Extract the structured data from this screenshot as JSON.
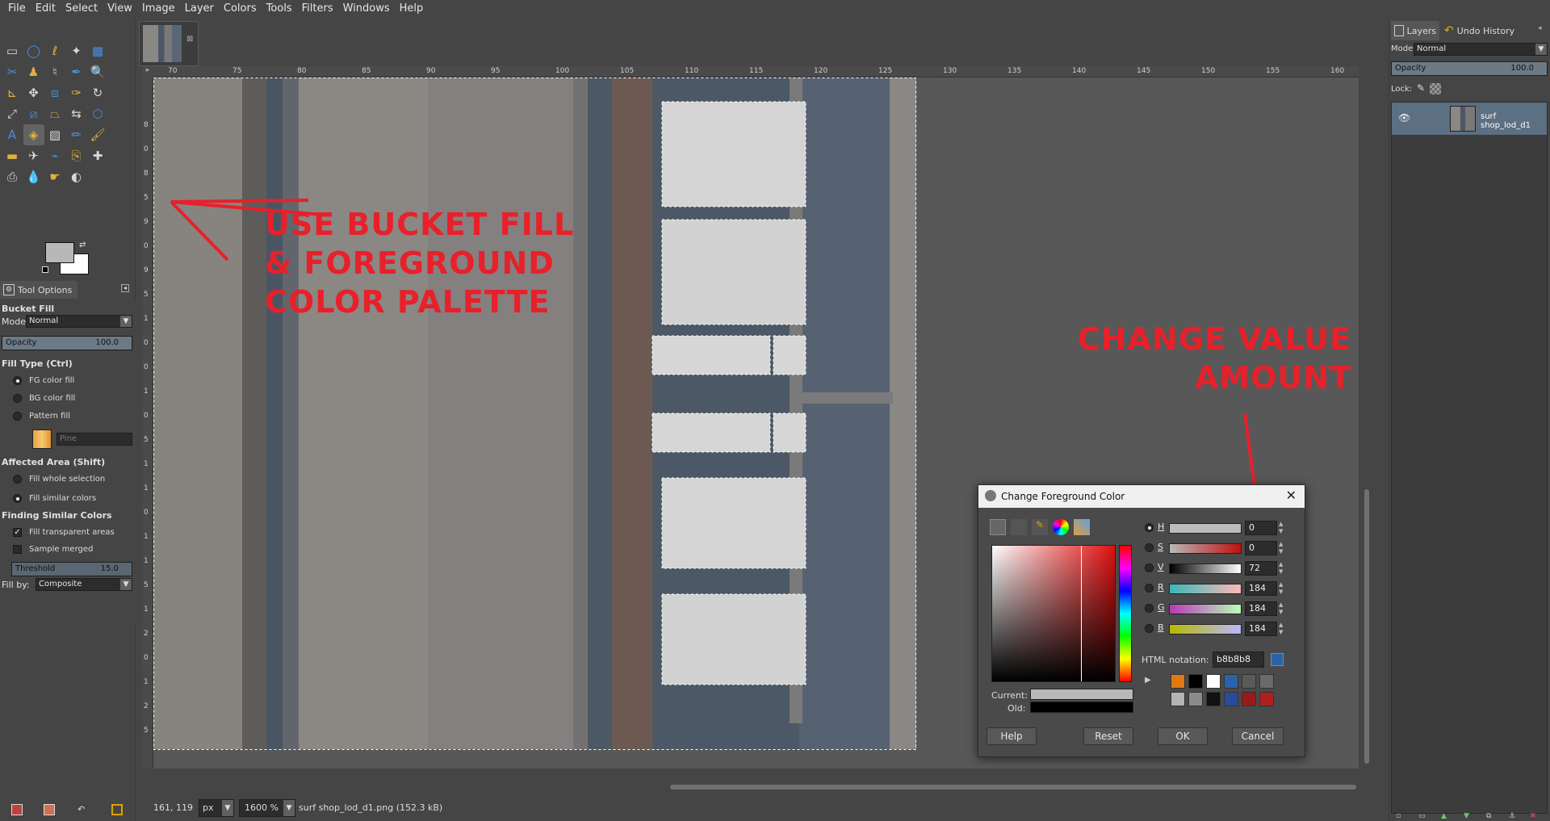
{
  "menu": [
    "File",
    "Edit",
    "Select",
    "View",
    "Image",
    "Layer",
    "Colors",
    "Tools",
    "Filters",
    "Windows",
    "Help"
  ],
  "tool_options": {
    "tab_label": "Tool Options",
    "tool_name": "Bucket Fill",
    "mode_label": "Mode:",
    "mode_value": "Normal",
    "opacity_label": "Opacity",
    "opacity_value": "100.0",
    "fill_type_label": "Fill Type  (Ctrl)",
    "fill_types": [
      "FG color fill",
      "BG color fill",
      "Pattern fill"
    ],
    "pattern_name": "Pine",
    "affected_area_label": "Affected Area  (Shift)",
    "affected_areas": [
      "Fill whole selection",
      "Fill similar colors"
    ],
    "finding_similar_label": "Finding Similar Colors",
    "fill_transparent": "Fill transparent areas",
    "sample_merged": "Sample merged",
    "threshold_label": "Threshold",
    "threshold_value": "15.0",
    "fill_by_label": "Fill by:",
    "fill_by_value": "Composite"
  },
  "ruler_top": [
    "70",
    "75",
    "80",
    "85",
    "90",
    "95",
    "100",
    "105",
    "110",
    "115",
    "120",
    "125",
    "130",
    "135",
    "140",
    "145",
    "150",
    "155",
    "160"
  ],
  "ruler_left": [
    "8",
    "0",
    "8",
    "5",
    "9",
    "0",
    "9",
    "5",
    "1",
    "0",
    "0",
    "1",
    "0",
    "5",
    "1",
    "1",
    "0",
    "1",
    "1",
    "5",
    "1",
    "2",
    "0",
    "1",
    "2",
    "5"
  ],
  "annotations": {
    "left_text": [
      "USE BUCKET FILL",
      "& FOREGROUND",
      "COLOR PALETTE"
    ],
    "right_text": [
      "CHANGE VALUE",
      "AMOUNT"
    ],
    "color": "#e8202a"
  },
  "status": {
    "coords": "161, 119",
    "unit": "px",
    "zoom": "1600 %",
    "file": "surf shop_lod_d1.png (152.3 kB)"
  },
  "dock": {
    "tab_layers": "Layers",
    "tab_undo": "Undo History",
    "mode_label": "Mode:",
    "mode_value": "Normal",
    "opacity_label": "Opacity",
    "opacity_value": "100.0",
    "lock_label": "Lock:",
    "layer_name": "surf shop_lod_d1"
  },
  "dialog": {
    "title": "Change Foreground Color",
    "channels": [
      {
        "label": "H",
        "value": "0",
        "on": true
      },
      {
        "label": "S",
        "value": "0",
        "on": false
      },
      {
        "label": "V",
        "value": "72",
        "on": false
      },
      {
        "label": "R",
        "value": "184",
        "on": false
      },
      {
        "label": "G",
        "value": "184",
        "on": false
      },
      {
        "label": "B",
        "value": "184",
        "on": false
      }
    ],
    "html_label": "HTML notation:",
    "html_value": "b8b8b8",
    "current_label": "Current:",
    "old_label": "Old:",
    "current_color": "#b8b8b8",
    "old_color": "#000000",
    "history_colors": [
      "#e07a10",
      "#000000",
      "#ffffff",
      "#2a64a8",
      "#5a5a5a",
      "#6a6a6a",
      "#b4b4b4",
      "#8a8a8a",
      "#111111",
      "#2a4a9a",
      "#9a1a1a",
      "#b02020"
    ],
    "buttons": {
      "help": "Help",
      "reset": "Reset",
      "ok": "OK",
      "cancel": "Cancel"
    }
  }
}
